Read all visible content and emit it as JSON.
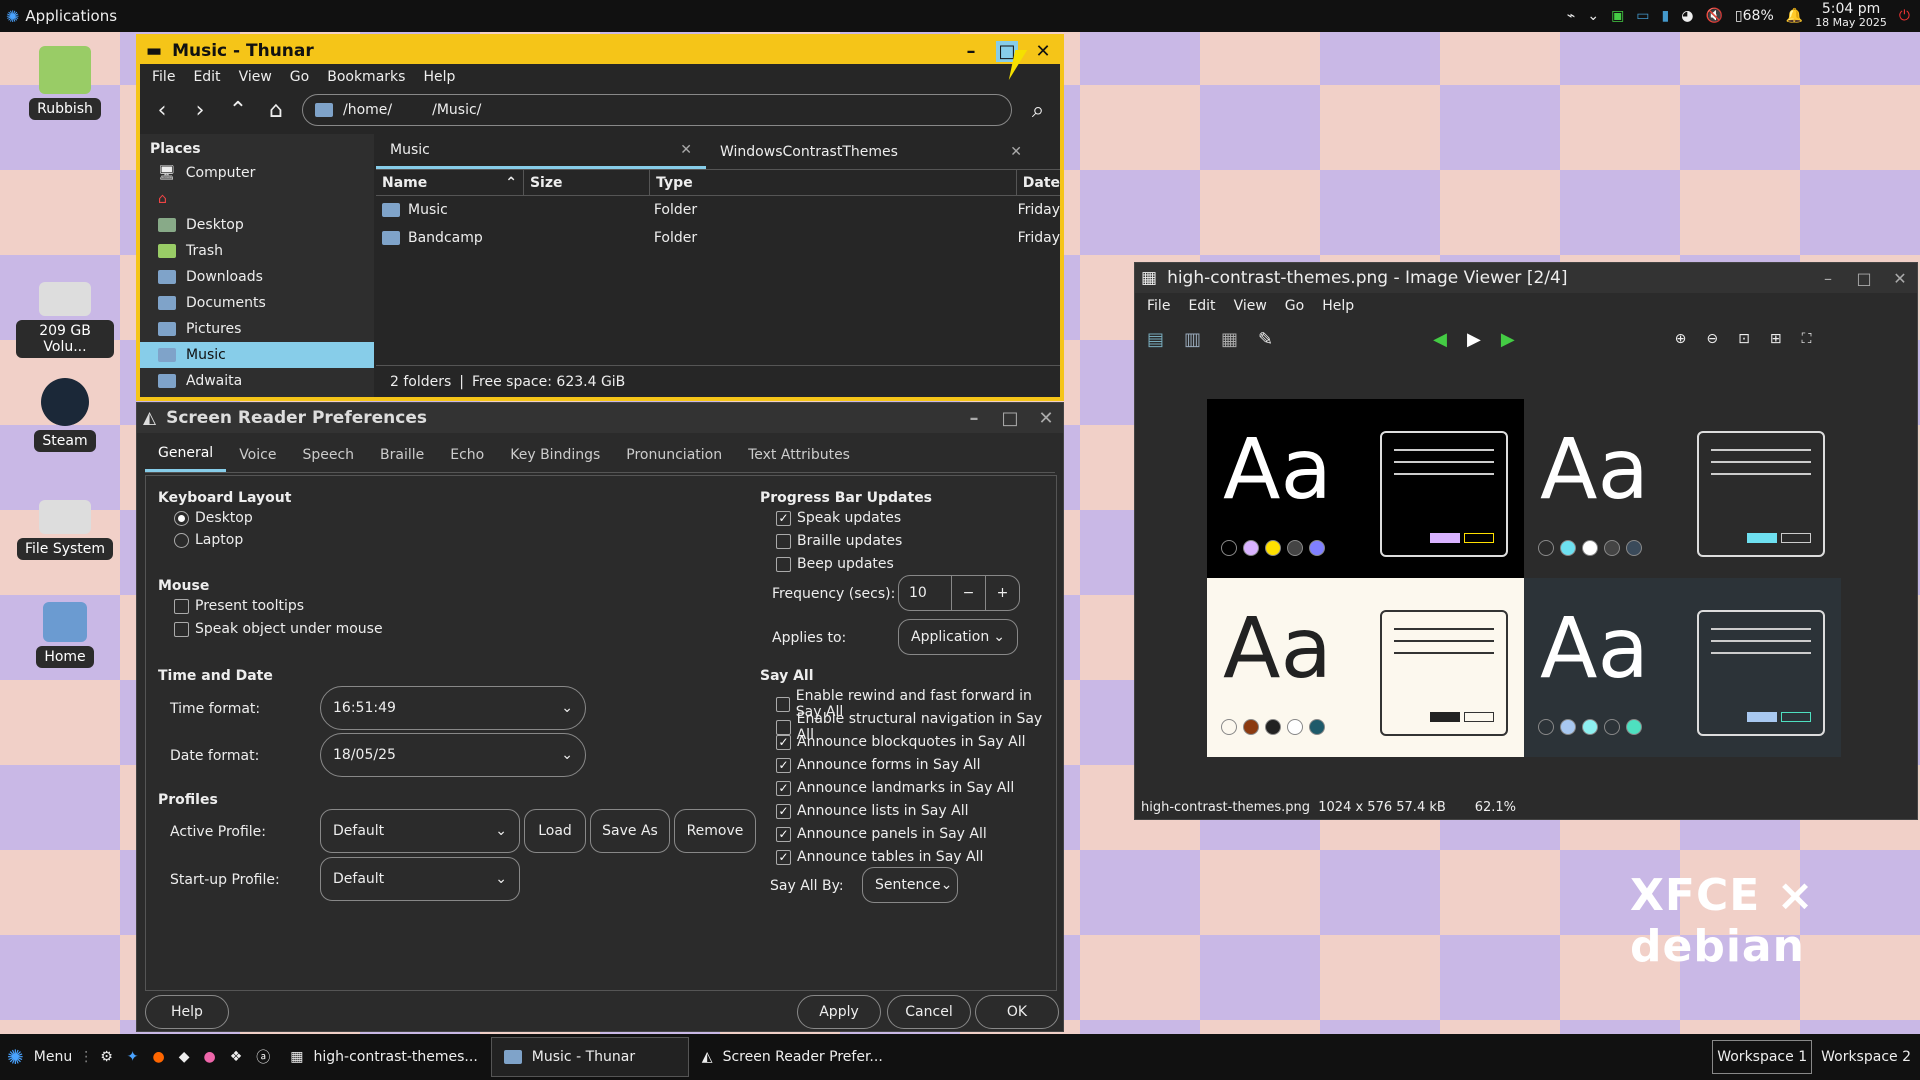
{
  "panel": {
    "apps_label": "Applications",
    "battery": "68%",
    "time": "5:04 pm",
    "date": "18 May 2025"
  },
  "desktop": {
    "icons": [
      {
        "label": "Rubbish"
      },
      {
        "label": "209 GB Volu..."
      },
      {
        "label": "Steam"
      },
      {
        "label": "File System"
      },
      {
        "label": "Home"
      }
    ]
  },
  "thunar": {
    "title": "Music - Thunar",
    "menus": [
      "File",
      "Edit",
      "View",
      "Go",
      "Bookmarks",
      "Help"
    ],
    "path": {
      "a": "/home/",
      "b": "/Music/"
    },
    "places_header": "Places",
    "places": [
      "Computer",
      "",
      "Desktop",
      "Trash",
      "Downloads",
      "Documents",
      "Pictures",
      "Music",
      "Adwaita"
    ],
    "tabs": [
      "Music",
      "WindowsContrastThemes"
    ],
    "columns": {
      "name": "Name",
      "size": "Size",
      "type": "Type",
      "date": "Date"
    },
    "rows": [
      {
        "name": "Music",
        "type": "Folder",
        "date": "Friday"
      },
      {
        "name": "Bandcamp",
        "type": "Folder",
        "date": "Friday"
      }
    ],
    "status": {
      "count": "2 folders",
      "sep": "|",
      "free": "Free space: 623.4 GiB"
    }
  },
  "orca": {
    "title": "Screen Reader Preferences",
    "tabs": [
      "General",
      "Voice",
      "Speech",
      "Braille",
      "Echo",
      "Key Bindings",
      "Pronunciation",
      "Text Attributes"
    ],
    "keyboard": {
      "header": "Keyboard Layout",
      "desktop": "Desktop",
      "laptop": "Laptop"
    },
    "mouse": {
      "header": "Mouse",
      "tooltips": "Present tooltips",
      "speak_obj": "Speak object under mouse"
    },
    "timedate": {
      "header": "Time and Date",
      "time_label": "Time format:",
      "time_value": "16:51:49",
      "date_label": "Date format:",
      "date_value": "18/05/25"
    },
    "profiles": {
      "header": "Profiles",
      "active_label": "Active Profile:",
      "active_value": "Default",
      "load": "Load",
      "saveas": "Save As",
      "remove": "Remove",
      "startup_label": "Start-up Profile:",
      "startup_value": "Default"
    },
    "progress": {
      "header": "Progress Bar Updates",
      "speak": "Speak updates",
      "braille": "Braille updates",
      "beep": "Beep updates",
      "freq_label": "Frequency (secs):",
      "freq_value": "10",
      "applies_label": "Applies to:",
      "applies_value": "Application"
    },
    "sayall": {
      "header": "Say All",
      "items": [
        {
          "label": "Enable rewind and fast forward in Say All",
          "checked": false
        },
        {
          "label": "Enable structural navigation in Say All",
          "checked": false
        },
        {
          "label": "Announce blockquotes in Say All",
          "checked": true
        },
        {
          "label": "Announce forms in Say All",
          "checked": true
        },
        {
          "label": "Announce landmarks in Say All",
          "checked": true
        },
        {
          "label": "Announce lists in Say All",
          "checked": true
        },
        {
          "label": "Announce panels in Say All",
          "checked": true
        },
        {
          "label": "Announce tables in Say All",
          "checked": true
        }
      ],
      "by_label": "Say All By:",
      "by_value": "Sentence"
    },
    "buttons": {
      "help": "Help",
      "apply": "Apply",
      "cancel": "Cancel",
      "ok": "OK"
    }
  },
  "viewer": {
    "title": "high-contrast-themes.png - Image Viewer [2/4]",
    "menus": [
      "File",
      "Edit",
      "View",
      "Go",
      "Help"
    ],
    "status": {
      "file": "high-contrast-themes.png",
      "dims": "1024 x 576",
      "size": "57.4 kB",
      "zoom": "62.1%"
    },
    "aa_text": "Aa"
  },
  "taskbar": {
    "menu": "Menu",
    "tasks": [
      "high-contrast-themes...",
      "Music - Thunar",
      "Screen Reader Prefer..."
    ],
    "workspaces": [
      "Workspace 1",
      "Workspace 2"
    ]
  },
  "logo": {
    "text": "XFCE × debian"
  },
  "colors": {
    "accent": "#87cde9",
    "thunar_title": "#f5c518"
  }
}
